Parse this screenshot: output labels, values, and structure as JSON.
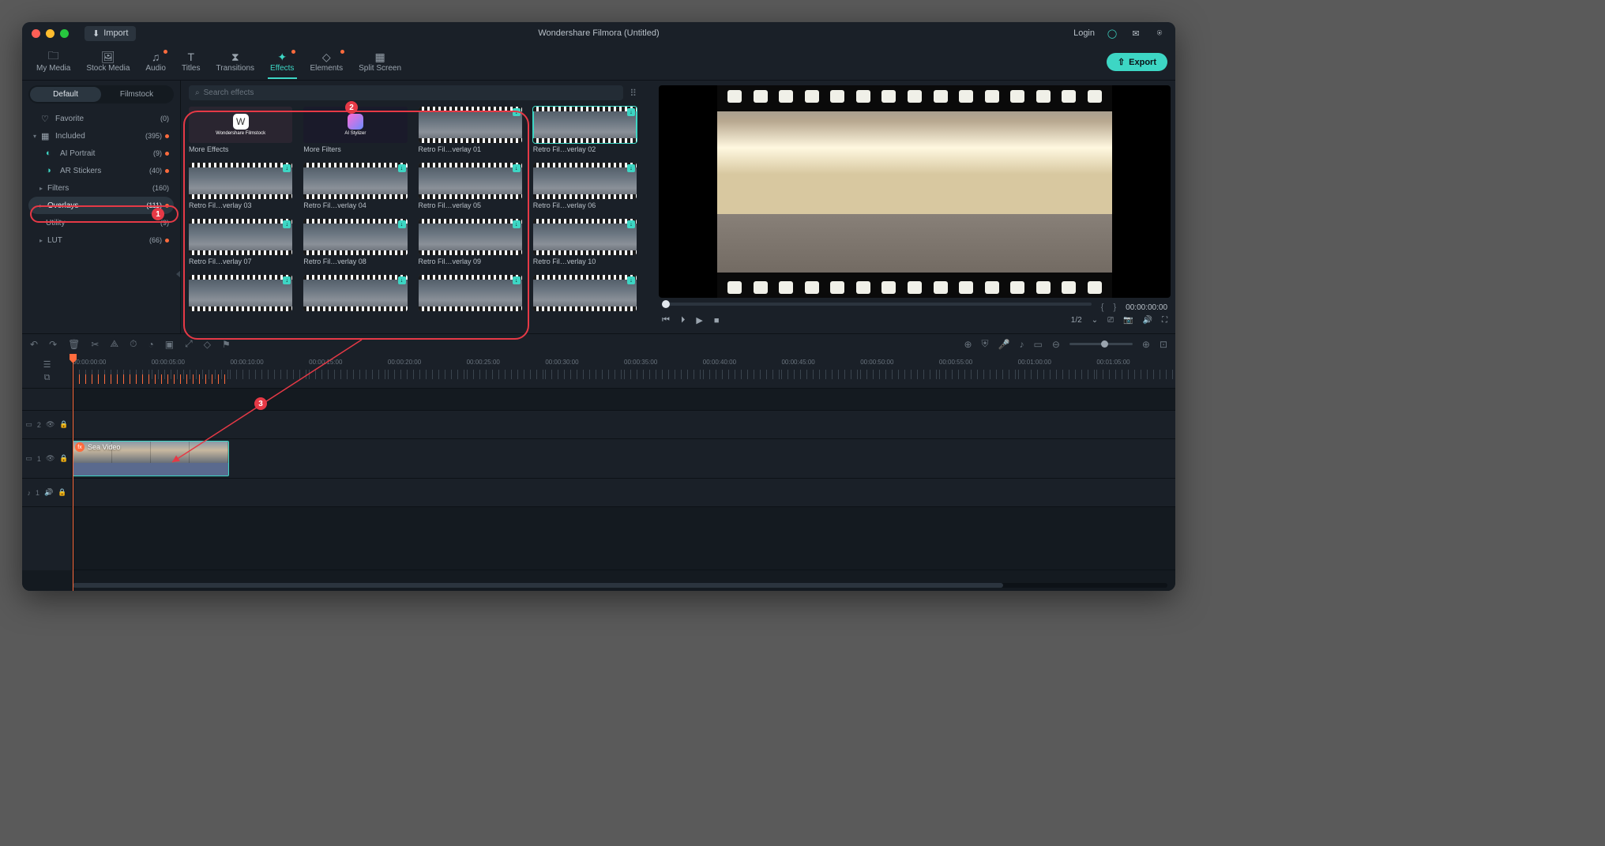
{
  "titlebar": {
    "import_label": "Import",
    "title": "Wondershare Filmora (Untitled)",
    "login_label": "Login"
  },
  "top_tabs": [
    {
      "label": "My Media",
      "icon": "folder",
      "active": false,
      "dot": false
    },
    {
      "label": "Stock Media",
      "icon": "image",
      "active": false,
      "dot": false
    },
    {
      "label": "Audio",
      "icon": "music",
      "active": false,
      "dot": true
    },
    {
      "label": "Titles",
      "icon": "text",
      "active": false,
      "dot": false
    },
    {
      "label": "Transitions",
      "icon": "triangle",
      "active": false,
      "dot": false
    },
    {
      "label": "Effects",
      "icon": "sparkle",
      "active": true,
      "dot": true
    },
    {
      "label": "Elements",
      "icon": "shapes",
      "active": false,
      "dot": true
    },
    {
      "label": "Split Screen",
      "icon": "grid",
      "active": false,
      "dot": false
    }
  ],
  "export_label": "Export",
  "left_tabs": {
    "default": "Default",
    "filmstock": "Filmstock",
    "active": "default"
  },
  "sidebar": [
    {
      "icon": "♡",
      "label": "Favorite",
      "count": "(0)",
      "chev": "",
      "dot": false
    },
    {
      "icon": "▦",
      "label": "Included",
      "count": "(395)",
      "chev": "▾",
      "dot": true
    },
    {
      "icon": "◐",
      "label": "AI Portrait",
      "count": "(9)",
      "chev": "",
      "dot": true,
      "indent": true,
      "teal": true
    },
    {
      "icon": "◑",
      "label": "AR Stickers",
      "count": "(40)",
      "chev": "",
      "dot": true,
      "indent": true,
      "teal": true
    },
    {
      "icon": "",
      "label": "Filters",
      "count": "(160)",
      "chev": "▸",
      "dot": false,
      "indent": true
    },
    {
      "icon": "",
      "label": "Overlays",
      "count": "(111)",
      "chev": "▸",
      "dot": true,
      "indent": true,
      "selected": true
    },
    {
      "icon": "",
      "label": "Utility",
      "count": "(9)",
      "chev": "",
      "dot": false,
      "indent": true
    },
    {
      "icon": "",
      "label": "LUT",
      "count": "(66)",
      "chev": "▸",
      "dot": true,
      "indent": true
    }
  ],
  "search_placeholder": "Search effects",
  "effects": [
    {
      "label": "More Effects",
      "kind": "ws"
    },
    {
      "label": "More Filters",
      "kind": "ai"
    },
    {
      "label": "Retro Fil…verlay 01",
      "kind": "film",
      "dl": true
    },
    {
      "label": "Retro Fil…verlay 02",
      "kind": "film",
      "dl": true,
      "selected": true
    },
    {
      "label": "Retro Fil…verlay 03",
      "kind": "film",
      "dl": true
    },
    {
      "label": "Retro Fil…verlay 04",
      "kind": "film",
      "dl": true
    },
    {
      "label": "Retro Fil…verlay 05",
      "kind": "film",
      "dl": true
    },
    {
      "label": "Retro Fil…verlay 06",
      "kind": "film",
      "dl": true
    },
    {
      "label": "Retro Fil…verlay 07",
      "kind": "film",
      "dl": true
    },
    {
      "label": "Retro Fil…verlay 08",
      "kind": "film",
      "dl": true
    },
    {
      "label": "Retro Fil…verlay 09",
      "kind": "film",
      "dl": true
    },
    {
      "label": "Retro Fil…verlay 10",
      "kind": "film",
      "dl": true
    },
    {
      "label": "",
      "kind": "film",
      "dl": true
    },
    {
      "label": "",
      "kind": "film",
      "dl": true
    },
    {
      "label": "",
      "kind": "film",
      "dl": true
    },
    {
      "label": "",
      "kind": "film",
      "dl": true
    }
  ],
  "ws_text": "Wondershare Filmstock",
  "ai_text": "AI Stylizer",
  "preview": {
    "timecode": "00:00:00:00",
    "ratio": "1/2"
  },
  "ruler_times": [
    "00:00:00:00",
    "00:00:05:00",
    "00:00:10:00",
    "00:00:15:00",
    "00:00:20:00",
    "00:00:25:00",
    "00:00:30:00",
    "00:00:35:00",
    "00:00:40:00",
    "00:00:45:00",
    "00:00:50:00",
    "00:00:55:00",
    "00:01:00:00",
    "00:01:05:00"
  ],
  "tracks": {
    "v2": "2",
    "v1": "1",
    "a1": "1"
  },
  "clip_label": "Sea Video",
  "annotations": {
    "n1": "1",
    "n2": "2",
    "n3": "3"
  }
}
